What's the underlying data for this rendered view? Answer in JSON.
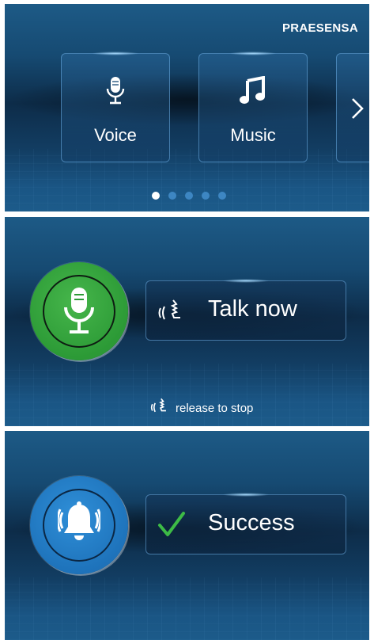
{
  "screen1": {
    "brand": "PRAESENSA",
    "tiles": [
      {
        "label": "Voice",
        "icon": "microphone-icon"
      },
      {
        "label": "Music",
        "icon": "music-note-icon"
      }
    ],
    "next_icon": "chevron-right-icon",
    "pagination": {
      "current": 1,
      "total": 5
    }
  },
  "screen2": {
    "circle_icon": "microphone-icon",
    "circle_color": "#2c9a36",
    "status_icon": "speaking-head-icon",
    "status_text": "Talk now",
    "hint_text": "release to stop"
  },
  "screen3": {
    "circle_icon": "bell-alarm-icon",
    "circle_color": "#1e73bb",
    "status_icon": "checkmark-icon",
    "status_color": "#3dbb46",
    "status_text": "Success"
  }
}
